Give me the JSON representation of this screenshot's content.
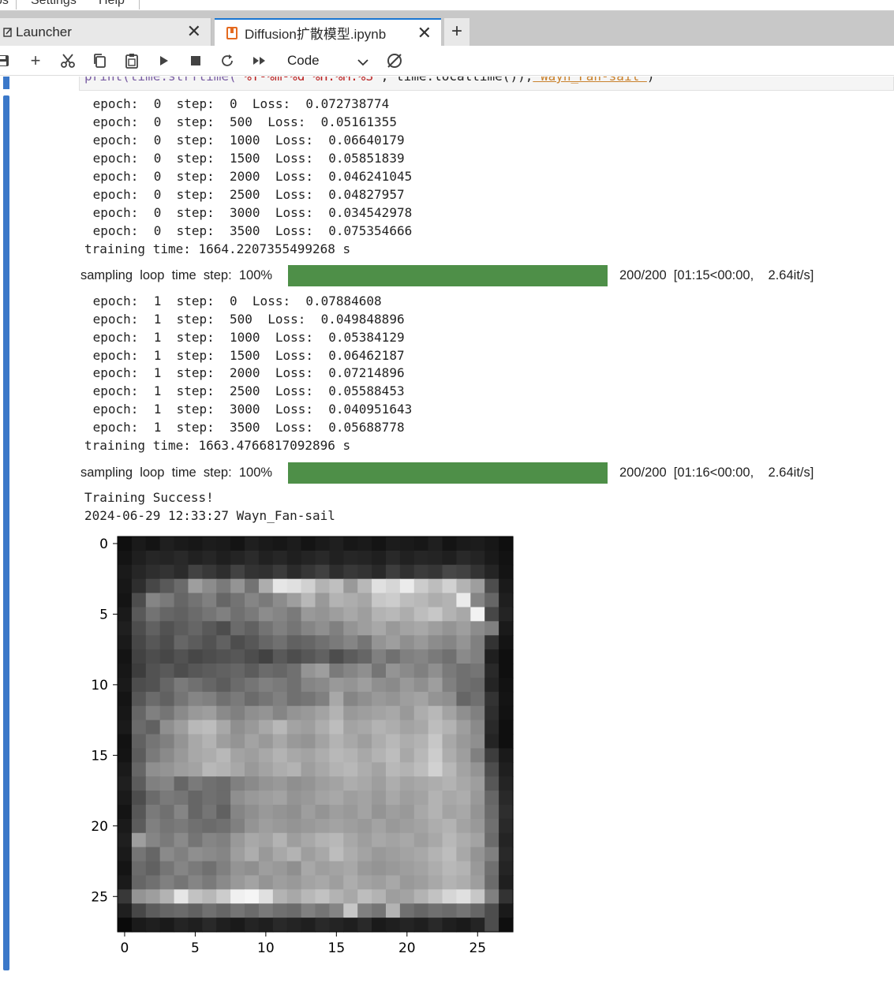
{
  "menubar": {
    "items": [
      "bs",
      "Settings",
      "Help"
    ]
  },
  "tabs": [
    {
      "label": "Launcher",
      "icon": "launcher-icon",
      "active": false
    },
    {
      "label": "Diffusion扩散模型.ipynb",
      "icon": "notebook-icon",
      "active": true
    }
  ],
  "toolbar": {
    "buttons": [
      "save-icon",
      "add-icon",
      "cut-icon",
      "copy-icon",
      "paste-icon",
      "run-icon",
      "stop-icon",
      "restart-icon",
      "run-all-icon"
    ],
    "cell_type": "Code",
    "kernel_icon": "kernel-status-icon"
  },
  "code_cell": {
    "fragment_fn": "print(time.strftime(",
    "fragment_str": "'%Y-%m-%d %H:%M:%S'",
    "fragment_mid": ", time.localtime()),",
    "fragment_hl": "'Wayn_Fan-sail'",
    "fragment_end": ")"
  },
  "output": {
    "epoch0": [
      " epoch:  0  step:  0  Loss:  0.072738774",
      " epoch:  0  step:  500  Loss:  0.05161355",
      " epoch:  0  step:  1000  Loss:  0.06640179",
      " epoch:  0  step:  1500  Loss:  0.05851839",
      " epoch:  0  step:  2000  Loss:  0.046241045",
      " epoch:  0  step:  2500  Loss:  0.04827957",
      " epoch:  0  step:  3000  Loss:  0.034542978",
      " epoch:  0  step:  3500  Loss:  0.075354666"
    ],
    "training_time_0": "training time: 1664.2207355499268 s",
    "progress_0": {
      "label": "sampling  loop  time  step:  100%",
      "percent": 100,
      "stats": "200/200  [01:15<00:00,    2.64it/s]"
    },
    "epoch1": [
      " epoch:  1  step:  0  Loss:  0.07884608",
      " epoch:  1  step:  500  Loss:  0.049848896",
      " epoch:  1  step:  1000  Loss:  0.05384129",
      " epoch:  1  step:  1500  Loss:  0.06462187",
      " epoch:  1  step:  2000  Loss:  0.07214896",
      " epoch:  1  step:  2500  Loss:  0.05588453",
      " epoch:  1  step:  3000  Loss:  0.040951643",
      " epoch:  1  step:  3500  Loss:  0.05688778"
    ],
    "training_time_1": "training time: 1663.4766817092896 s",
    "progress_1": {
      "label": "sampling  loop  time  step:  100%",
      "percent": 100,
      "stats": "200/200  [01:16<00:00,    2.64it/s]"
    },
    "success": "Training Success!",
    "timestamp": "2024-06-29 12:33:27 Wayn_Fan-sail"
  },
  "chart_data": {
    "type": "heatmap",
    "title": "",
    "xlabel": "",
    "ylabel": "",
    "x_ticks": [
      "0",
      "5",
      "10",
      "15",
      "20",
      "25"
    ],
    "y_ticks": [
      "0",
      "5",
      "10",
      "15",
      "20",
      "25"
    ],
    "xlim": [
      -0.5,
      27.5
    ],
    "ylim": [
      27.5,
      -0.5
    ],
    "colormap": "gray",
    "rows": 28,
    "cols": 28,
    "values": [
      [
        0.06,
        0.1,
        0.08,
        0.12,
        0.1,
        0.09,
        0.11,
        0.1,
        0.08,
        0.12,
        0.1,
        0.09,
        0.11,
        0.08,
        0.1,
        0.12,
        0.09,
        0.1,
        0.08,
        0.11,
        0.1,
        0.09,
        0.12,
        0.08,
        0.1,
        0.11,
        0.09,
        0.06
      ],
      [
        0.08,
        0.12,
        0.15,
        0.14,
        0.16,
        0.13,
        0.15,
        0.12,
        0.14,
        0.17,
        0.13,
        0.15,
        0.12,
        0.14,
        0.16,
        0.13,
        0.15,
        0.14,
        0.12,
        0.16,
        0.13,
        0.15,
        0.14,
        0.12,
        0.16,
        0.14,
        0.1,
        0.07
      ],
      [
        0.1,
        0.15,
        0.18,
        0.2,
        0.17,
        0.26,
        0.22,
        0.18,
        0.26,
        0.2,
        0.19,
        0.23,
        0.17,
        0.21,
        0.25,
        0.18,
        0.22,
        0.2,
        0.16,
        0.24,
        0.19,
        0.23,
        0.21,
        0.28,
        0.26,
        0.2,
        0.14,
        0.08
      ],
      [
        0.09,
        0.18,
        0.28,
        0.35,
        0.42,
        0.62,
        0.55,
        0.48,
        0.58,
        0.45,
        0.68,
        0.9,
        0.88,
        0.82,
        0.7,
        0.75,
        0.6,
        0.72,
        0.88,
        0.84,
        0.92,
        0.8,
        0.74,
        0.82,
        0.7,
        0.62,
        0.3,
        0.1
      ],
      [
        0.08,
        0.3,
        0.52,
        0.48,
        0.4,
        0.45,
        0.5,
        0.4,
        0.45,
        0.52,
        0.48,
        0.55,
        0.62,
        0.72,
        0.6,
        0.7,
        0.68,
        0.65,
        0.78,
        0.8,
        0.74,
        0.72,
        0.68,
        0.7,
        0.92,
        0.52,
        0.4,
        0.12
      ],
      [
        0.1,
        0.35,
        0.45,
        0.4,
        0.38,
        0.42,
        0.46,
        0.5,
        0.44,
        0.48,
        0.55,
        0.52,
        0.48,
        0.6,
        0.58,
        0.62,
        0.66,
        0.62,
        0.7,
        0.72,
        0.68,
        0.74,
        0.78,
        0.7,
        0.66,
        0.95,
        0.28,
        0.14
      ],
      [
        0.12,
        0.3,
        0.38,
        0.32,
        0.36,
        0.4,
        0.35,
        0.3,
        0.42,
        0.38,
        0.45,
        0.5,
        0.46,
        0.52,
        0.56,
        0.5,
        0.58,
        0.62,
        0.66,
        0.6,
        0.64,
        0.66,
        0.62,
        0.58,
        0.62,
        0.55,
        0.5,
        0.1
      ],
      [
        0.1,
        0.28,
        0.34,
        0.3,
        0.4,
        0.36,
        0.32,
        0.38,
        0.3,
        0.34,
        0.4,
        0.44,
        0.38,
        0.4,
        0.44,
        0.48,
        0.52,
        0.46,
        0.58,
        0.62,
        0.56,
        0.6,
        0.55,
        0.52,
        0.58,
        0.5,
        0.2,
        0.08
      ],
      [
        0.08,
        0.26,
        0.3,
        0.28,
        0.32,
        0.28,
        0.3,
        0.32,
        0.34,
        0.3,
        0.26,
        0.35,
        0.3,
        0.34,
        0.38,
        0.3,
        0.36,
        0.4,
        0.5,
        0.44,
        0.5,
        0.52,
        0.48,
        0.44,
        0.54,
        0.5,
        0.12,
        0.06
      ],
      [
        0.09,
        0.24,
        0.32,
        0.35,
        0.3,
        0.34,
        0.36,
        0.38,
        0.4,
        0.36,
        0.42,
        0.4,
        0.44,
        0.58,
        0.62,
        0.48,
        0.52,
        0.56,
        0.46,
        0.58,
        0.54,
        0.5,
        0.56,
        0.48,
        0.44,
        0.46,
        0.16,
        0.06
      ],
      [
        0.1,
        0.3,
        0.32,
        0.4,
        0.48,
        0.44,
        0.4,
        0.36,
        0.42,
        0.46,
        0.5,
        0.48,
        0.44,
        0.52,
        0.54,
        0.6,
        0.58,
        0.62,
        0.56,
        0.54,
        0.6,
        0.56,
        0.62,
        0.5,
        0.44,
        0.42,
        0.14,
        0.07
      ],
      [
        0.08,
        0.34,
        0.42,
        0.38,
        0.46,
        0.52,
        0.5,
        0.44,
        0.48,
        0.42,
        0.46,
        0.5,
        0.44,
        0.46,
        0.5,
        0.66,
        0.52,
        0.56,
        0.6,
        0.58,
        0.62,
        0.64,
        0.58,
        0.56,
        0.4,
        0.44,
        0.2,
        0.08
      ],
      [
        0.09,
        0.4,
        0.5,
        0.46,
        0.54,
        0.6,
        0.62,
        0.54,
        0.5,
        0.56,
        0.58,
        0.52,
        0.58,
        0.6,
        0.64,
        0.7,
        0.6,
        0.62,
        0.64,
        0.66,
        0.6,
        0.68,
        0.72,
        0.64,
        0.56,
        0.5,
        0.18,
        0.07
      ],
      [
        0.1,
        0.42,
        0.38,
        0.56,
        0.62,
        0.72,
        0.74,
        0.66,
        0.56,
        0.6,
        0.66,
        0.72,
        0.64,
        0.62,
        0.68,
        0.74,
        0.64,
        0.66,
        0.7,
        0.68,
        0.64,
        0.66,
        0.74,
        0.7,
        0.62,
        0.54,
        0.16,
        0.06
      ],
      [
        0.07,
        0.38,
        0.46,
        0.5,
        0.58,
        0.66,
        0.7,
        0.62,
        0.58,
        0.64,
        0.6,
        0.66,
        0.6,
        0.58,
        0.64,
        0.7,
        0.66,
        0.62,
        0.68,
        0.72,
        0.68,
        0.7,
        0.78,
        0.66,
        0.6,
        0.56,
        0.14,
        0.06
      ],
      [
        0.08,
        0.36,
        0.48,
        0.54,
        0.6,
        0.66,
        0.68,
        0.72,
        0.64,
        0.62,
        0.66,
        0.7,
        0.66,
        0.64,
        0.68,
        0.72,
        0.7,
        0.66,
        0.7,
        0.74,
        0.66,
        0.72,
        0.8,
        0.68,
        0.62,
        0.5,
        0.24,
        0.1
      ],
      [
        0.1,
        0.4,
        0.56,
        0.58,
        0.62,
        0.64,
        0.72,
        0.7,
        0.66,
        0.6,
        0.64,
        0.68,
        0.7,
        0.62,
        0.66,
        0.7,
        0.72,
        0.68,
        0.64,
        0.72,
        0.7,
        0.74,
        0.82,
        0.72,
        0.64,
        0.58,
        0.3,
        0.12
      ],
      [
        0.12,
        0.36,
        0.5,
        0.52,
        0.4,
        0.48,
        0.44,
        0.42,
        0.5,
        0.54,
        0.58,
        0.6,
        0.56,
        0.58,
        0.62,
        0.64,
        0.68,
        0.66,
        0.62,
        0.68,
        0.64,
        0.66,
        0.68,
        0.7,
        0.66,
        0.62,
        0.34,
        0.14
      ],
      [
        0.1,
        0.3,
        0.42,
        0.48,
        0.46,
        0.4,
        0.44,
        0.42,
        0.56,
        0.6,
        0.62,
        0.64,
        0.58,
        0.6,
        0.64,
        0.66,
        0.62,
        0.64,
        0.6,
        0.66,
        0.62,
        0.64,
        0.7,
        0.66,
        0.68,
        0.6,
        0.4,
        0.16
      ],
      [
        0.08,
        0.34,
        0.48,
        0.44,
        0.52,
        0.4,
        0.46,
        0.38,
        0.52,
        0.56,
        0.6,
        0.58,
        0.56,
        0.62,
        0.58,
        0.62,
        0.6,
        0.64,
        0.58,
        0.62,
        0.6,
        0.66,
        0.7,
        0.64,
        0.66,
        0.58,
        0.42,
        0.18
      ],
      [
        0.1,
        0.36,
        0.5,
        0.46,
        0.48,
        0.44,
        0.42,
        0.44,
        0.5,
        0.58,
        0.62,
        0.6,
        0.58,
        0.6,
        0.62,
        0.64,
        0.62,
        0.6,
        0.64,
        0.6,
        0.62,
        0.64,
        0.68,
        0.7,
        0.64,
        0.6,
        0.44,
        0.16
      ],
      [
        0.12,
        0.62,
        0.52,
        0.48,
        0.54,
        0.46,
        0.52,
        0.5,
        0.6,
        0.66,
        0.64,
        0.7,
        0.62,
        0.66,
        0.7,
        0.72,
        0.66,
        0.62,
        0.66,
        0.64,
        0.66,
        0.62,
        0.66,
        0.72,
        0.68,
        0.64,
        0.42,
        0.14
      ],
      [
        0.1,
        0.46,
        0.4,
        0.54,
        0.5,
        0.56,
        0.54,
        0.52,
        0.62,
        0.68,
        0.6,
        0.66,
        0.7,
        0.62,
        0.66,
        0.74,
        0.68,
        0.64,
        0.6,
        0.62,
        0.64,
        0.66,
        0.7,
        0.74,
        0.66,
        0.58,
        0.5,
        0.16
      ],
      [
        0.08,
        0.42,
        0.38,
        0.46,
        0.52,
        0.48,
        0.44,
        0.5,
        0.58,
        0.56,
        0.62,
        0.6,
        0.56,
        0.66,
        0.62,
        0.64,
        0.66,
        0.6,
        0.58,
        0.6,
        0.62,
        0.64,
        0.68,
        0.72,
        0.7,
        0.6,
        0.44,
        0.14
      ],
      [
        0.1,
        0.4,
        0.44,
        0.5,
        0.46,
        0.52,
        0.48,
        0.54,
        0.6,
        0.64,
        0.58,
        0.62,
        0.6,
        0.64,
        0.66,
        0.62,
        0.68,
        0.64,
        0.62,
        0.66,
        0.6,
        0.62,
        0.66,
        0.7,
        0.68,
        0.62,
        0.42,
        0.12
      ],
      [
        0.22,
        0.58,
        0.62,
        0.7,
        0.9,
        0.76,
        0.72,
        0.8,
        0.94,
        0.96,
        0.88,
        0.7,
        0.66,
        0.72,
        0.76,
        0.7,
        0.66,
        0.74,
        0.7,
        0.62,
        0.64,
        0.7,
        0.76,
        0.84,
        0.88,
        0.78,
        0.5,
        0.2
      ],
      [
        0.12,
        0.28,
        0.36,
        0.4,
        0.42,
        0.38,
        0.44,
        0.4,
        0.46,
        0.42,
        0.48,
        0.44,
        0.42,
        0.5,
        0.46,
        0.52,
        0.78,
        0.5,
        0.46,
        0.7,
        0.44,
        0.4,
        0.44,
        0.42,
        0.46,
        0.4,
        0.3,
        0.1
      ],
      [
        0.04,
        0.1,
        0.12,
        0.1,
        0.14,
        0.12,
        0.16,
        0.12,
        0.1,
        0.14,
        0.12,
        0.16,
        0.14,
        0.12,
        0.16,
        0.14,
        0.12,
        0.16,
        0.1,
        0.12,
        0.14,
        0.12,
        0.16,
        0.12,
        0.1,
        0.14,
        0.3,
        0.06
      ]
    ]
  }
}
